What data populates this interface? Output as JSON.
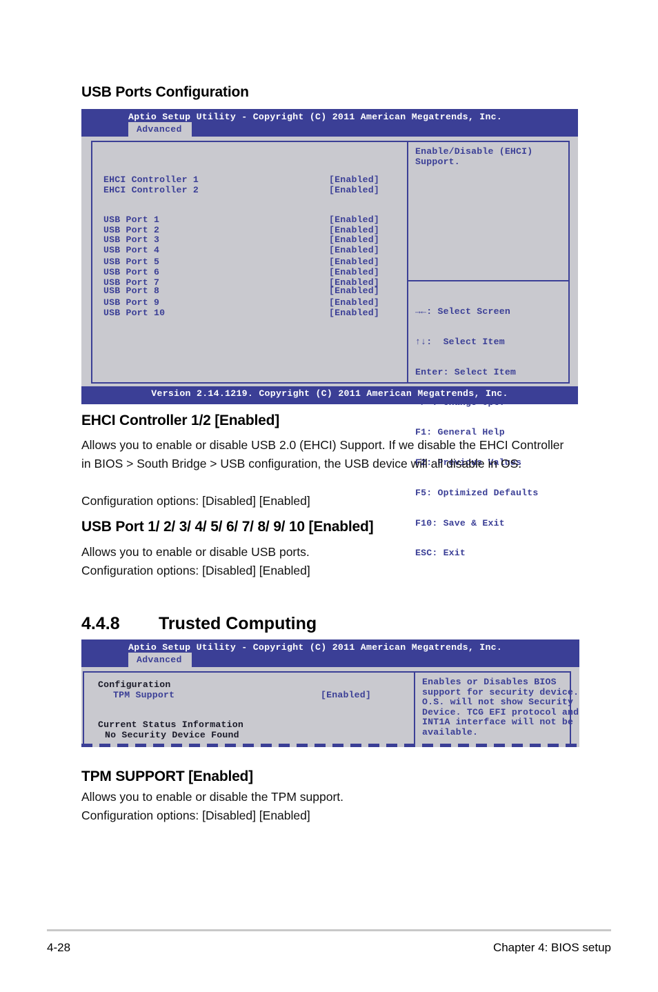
{
  "section_usb": {
    "heading": "USB Ports Configuration"
  },
  "bios_screen_usb": {
    "title": "Aptio Setup Utility - Copyright (C) 2011 American Megatrends, Inc.",
    "tab": "Advanced",
    "items": [
      {
        "label": "EHCI Controller 1",
        "value": "[Enabled]"
      },
      {
        "label": "EHCI Controller 2",
        "value": "[Enabled]"
      },
      {
        "label": "USB Port 1",
        "value": "[Enabled]"
      },
      {
        "label": "USB Port 2",
        "value": "[Enabled]"
      },
      {
        "label": "USB Port 3",
        "value": "[Enabled]"
      },
      {
        "label": "USB Port 4",
        "value": "[Enabled]"
      },
      {
        "label": "USB Port 5",
        "value": "[Enabled]"
      },
      {
        "label": "USB Port 6",
        "value": "[Enabled]"
      },
      {
        "label": "USB Port 7",
        "value": "[Enabled]"
      },
      {
        "label": "USB Port 8",
        "value": "[Enabled]"
      },
      {
        "label": "USB Port 9",
        "value": "[Enabled]"
      },
      {
        "label": "USB Port 10",
        "value": "[Enabled]"
      }
    ],
    "help": "Enable/Disable (EHCI)\nSupport.",
    "navkeys": [
      "→←: Select Screen",
      "↑↓:  Select Item",
      "Enter: Select Item",
      "+/-: Change Opt.",
      "F1: General Help",
      "F2: Previous Values",
      "F5: Optimized Defaults",
      "F10: Save & Exit",
      "ESC: Exit"
    ],
    "version": "Version 2.14.1219. Copyright (C) 2011 American Megatrends, Inc."
  },
  "desc_ehci": {
    "heading": "EHCI Controller 1/2 [Enabled]",
    "body": "Allows you to enable or disable USB 2.0 (EHCI) Support. If we disable the EHCI Controller in BIOS > South Bridge > USB configuration, the USB device will all disable in OS.",
    "options": "Configuration options: [Disabled] [Enabled]"
  },
  "desc_usb_port": {
    "heading": "USB Port 1/ 2/ 3/ 4/ 5/ 6/ 7/ 8/ 9/ 10 [Enabled]",
    "body": "Allows you to enable or disable USB ports.",
    "options": "Configuration options: [Disabled] [Enabled]"
  },
  "section_tpm": {
    "number": "4.4.8",
    "title": "Trusted Computing"
  },
  "bios_screen_tpm": {
    "title": "Aptio Setup Utility - Copyright (C) 2011 American Megatrends, Inc.",
    "tab": "Advanced",
    "group_configuration": "Configuration",
    "tpm_support_label": "TPM Support",
    "tpm_support_value": "[Enabled]",
    "group_status": "Current Status Information",
    "status_value": "No Security Device Found",
    "help": "Enables or Disables BIOS\nsupport for security device.\nO.S. will not show Security\nDevice. TCG EFI protocol and\nINT1A interface will not be\navailable."
  },
  "desc_tpm": {
    "heading": "TPM SUPPORT [Enabled]",
    "body": "Allows you to enable or disable the TPM support.",
    "options": "Configuration options: [Disabled] [Enabled]"
  },
  "page_footer": {
    "page_number": "4-28",
    "chapter": "Chapter 4: BIOS setup"
  },
  "colors": {
    "bios_blue": "#3b3f96",
    "bios_gray": "#c9c9cf"
  }
}
